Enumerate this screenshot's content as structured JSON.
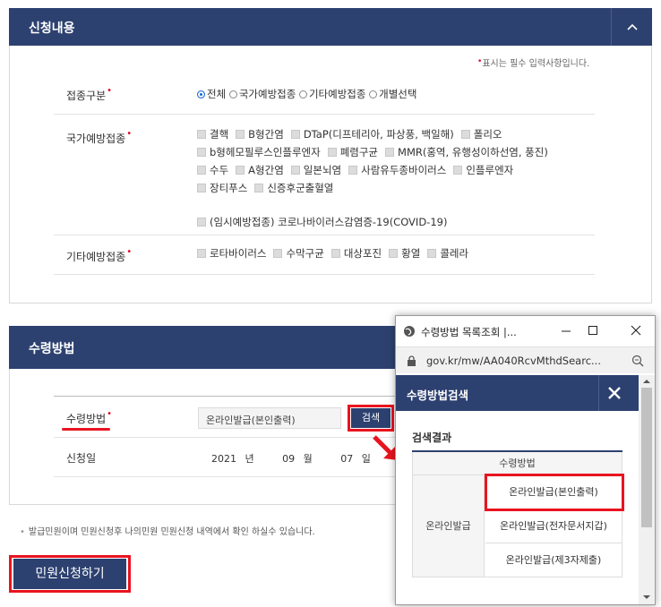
{
  "section1": {
    "title": "신청내용",
    "required_note": "표시는 필수 입력사항입니다.",
    "row_type": {
      "label": "접종구분",
      "options": [
        "전체",
        "국가예방접종",
        "기타예방접종",
        "개별선택"
      ],
      "selected": "전체"
    },
    "row_national": {
      "label": "국가예방접종",
      "line1": [
        "결핵",
        "B형간염",
        "DTaP(디프테리아, 파상풍, 백일해)",
        "폴리오"
      ],
      "line2": [
        "b형헤모필루스인플루엔자",
        "폐렴구균",
        "MMR(홍역, 유행성이하선염, 풍진)"
      ],
      "line3": [
        "수두",
        "A형간염",
        "일본뇌염",
        "사람유두종바이러스",
        "인플루엔자"
      ],
      "line4": [
        "장티푸스",
        "신증후군출혈열"
      ],
      "line5": [
        "(임시예방접종) 코로나바이러스감염증-19(COVID-19)"
      ]
    },
    "row_other": {
      "label": "기타예방접종",
      "options": [
        "로타바이러스",
        "수막구균",
        "대상포진",
        "황열",
        "콜레라"
      ]
    }
  },
  "section2": {
    "title": "수령방법",
    "method_label": "수령방법",
    "method_value": "온라인발급(본인출력)",
    "search_button": "검색",
    "date_label": "신청일",
    "year": "2021",
    "year_unit": "년",
    "month": "09",
    "month_unit": "월",
    "day": "07",
    "day_unit": "일"
  },
  "notice": "발급민원이며 민원신청후 나의민원 민원신청 내역에서 확인 하실수 있습니다.",
  "submit_button": "민원신청하기",
  "popup": {
    "window_title": "수령방법 목록조회 |...",
    "url": "gov.kr/mw/AA040RcvMthdSearc...",
    "header": "수령방법검색",
    "result_title": "검색결과",
    "table_header": "수령방법",
    "category": "온라인발급",
    "items": [
      "온라인발급(본인출력)",
      "온라인발급(전자문서지갑)",
      "온라인발급(제3자제출)"
    ]
  },
  "colors": {
    "header_bg": "#2d4170",
    "highlight": "#e8141f",
    "required": "#e1001e"
  }
}
